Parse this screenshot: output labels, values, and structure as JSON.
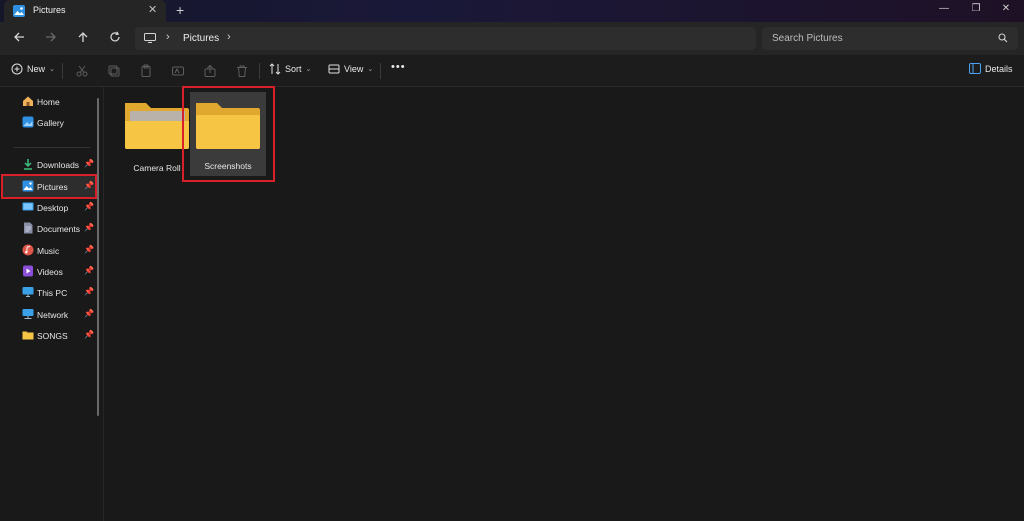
{
  "window": {
    "tab_title": "Pictures",
    "new_tab_symbol": "+",
    "close_tab_symbol": "✕",
    "minimize_symbol": "—",
    "restore_symbol": "❐",
    "close_symbol": "✕"
  },
  "nav": {
    "back_icon": "arrow-left-icon",
    "forward_icon": "arrow-right-icon",
    "up_icon": "arrow-up-icon",
    "refresh_icon": "refresh-icon",
    "breadcrumb": [
      "Pictures"
    ],
    "search_placeholder": "Search Pictures"
  },
  "commands": {
    "new_label": "New",
    "sort_label": "Sort",
    "view_label": "View",
    "more_label": "•••",
    "details_label": "Details"
  },
  "sidebar": {
    "items": [
      {
        "label": "Home",
        "icon": "home-icon",
        "pinned": false
      },
      {
        "label": "Gallery",
        "icon": "gallery-icon",
        "pinned": false
      },
      {
        "label": "Downloads",
        "icon": "download-icon",
        "pinned": true
      },
      {
        "label": "Pictures",
        "icon": "pictures-icon",
        "pinned": true,
        "selected": true
      },
      {
        "label": "Desktop",
        "icon": "desktop-icon",
        "pinned": true
      },
      {
        "label": "Documents",
        "icon": "documents-icon",
        "pinned": true
      },
      {
        "label": "Music",
        "icon": "music-icon",
        "pinned": true
      },
      {
        "label": "Videos",
        "icon": "videos-icon",
        "pinned": true
      },
      {
        "label": "This PC",
        "icon": "this-pc-icon",
        "pinned": true
      },
      {
        "label": "Network",
        "icon": "network-icon",
        "pinned": true
      },
      {
        "label": "SONGS",
        "icon": "folder-icon",
        "pinned": true
      }
    ]
  },
  "content": {
    "folders": [
      {
        "name": "Camera Roll",
        "has_preview": true
      },
      {
        "name": "Screenshots",
        "has_preview": false,
        "selected": true
      }
    ]
  },
  "colors": {
    "highlight": "#d8202b",
    "folder": "#f6c544",
    "background": "#191919"
  }
}
